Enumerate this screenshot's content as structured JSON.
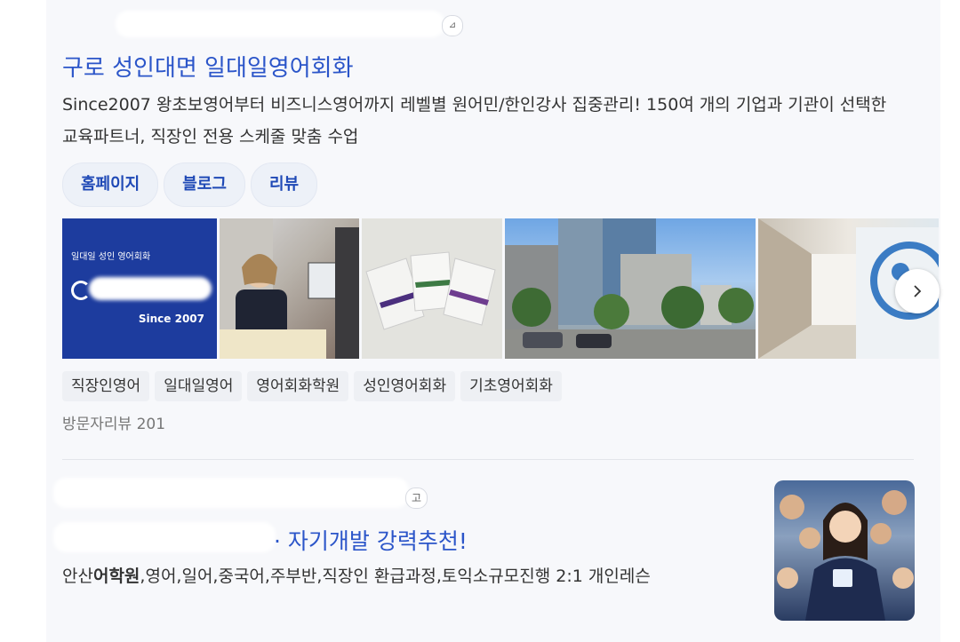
{
  "ad1": {
    "badge": "광고",
    "title": "구로 성인대면 일대일영어회화",
    "description": "Since2007 왕초보영어부터 비즈니스영어까지 레벨별 원어민/한인강사 집중관리! 150여 개의 기업과 기관이 선택한 교육파트너, 직장인 전용 스케줄 맞춤 수업",
    "links": [
      "홈페이지",
      "블로그",
      "리뷰"
    ],
    "gallery_logo": {
      "tagline": "일대일 성인 영어회화",
      "since": "Since 2007"
    },
    "next_icon": "chevron-right-icon",
    "tags": [
      "직장인영어",
      "일대일영어",
      "영어회화학원",
      "성인영어회화",
      "기초영어회화"
    ],
    "reviews": "방문자리뷰 201"
  },
  "ad2": {
    "badge": "고",
    "title": "· 자기개발 강력추천!",
    "description_bold": "어학원",
    "description_pre": "안산",
    "description_post": ",영어,일어,중국어,주부반,직장인 환급과정,토익소규모진행 2:1 개인레슨"
  },
  "colors": {
    "link_blue": "#2b55c9",
    "chip_bg": "#edf1f8",
    "logo_blue": "#1d3c9e"
  }
}
